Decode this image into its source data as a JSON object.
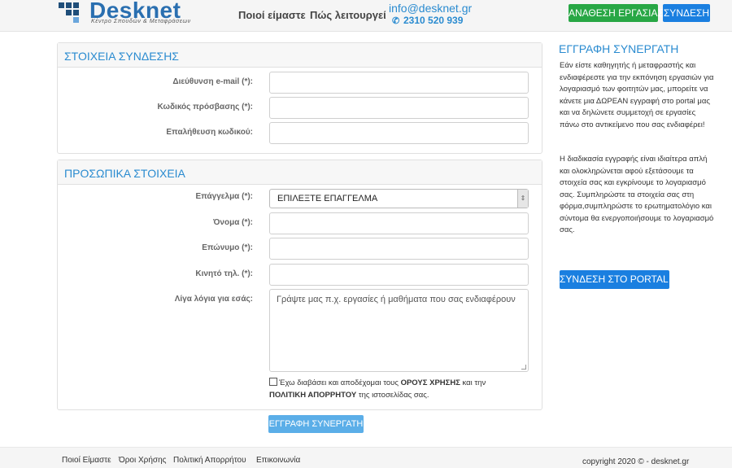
{
  "header": {
    "logo_text": "Desknet",
    "logo_subtitle": "Κέντρο Σπουδών & Μεταφράσεων",
    "nav": [
      "Ποιοί είμαστε",
      "Πώς λειτουργεί"
    ],
    "email": "info@desknet.gr",
    "phone": "2310 520 939",
    "assign_button": "ΑΝΑΘΕΣΗ ΕΡΓΑΣΙΑΣ",
    "login_button": "ΣΥΝΔΕΣΗ",
    "colors": {
      "green": "#28a745",
      "blue": "#1a7fe0"
    }
  },
  "login_section": {
    "title": "ΣΤΟΙΧΕΙΑ ΣΥΝΔΕΣΗΣ",
    "fields": [
      {
        "label": "Διεύθυνση e-mail (*):",
        "value": ""
      },
      {
        "label": "Κωδικός πρόσβασης (*):",
        "value": ""
      },
      {
        "label": "Επαλήθευση κωδικού:",
        "value": ""
      }
    ]
  },
  "personal_section": {
    "title": "ΠΡΟΣΩΠΙΚΑ ΣΤΟΙΧΕΙΑ",
    "profession_label": "Επάγγελμα (*):",
    "profession_selected": "ΕΠΙΛΕΞΤΕ ΕΠΑΓΓΕΛΜΑ",
    "fields": [
      {
        "label": "Όνομα (*):",
        "value": ""
      },
      {
        "label": "Επώνυμο (*):",
        "value": ""
      },
      {
        "label": "Κινητό τηλ. (*):",
        "value": ""
      }
    ],
    "about_label": "Λίγα λόγια για εσάς:",
    "about_placeholder": "Γράψτε μας π.χ. εργασίες ή μαθήματα που σας ενδιαφέρουν",
    "terms_pre": "Έχω διαβάσει και αποδέχομαι τους",
    "terms_link": "ΟΡΟΥΣ ΧΡΗΣΗΣ",
    "terms_mid": "και την",
    "privacy_link": "ΠΟΛΙΤΙΚΗ ΑΠΟΡΡΗΤΟΥ",
    "terms_post": "της ιστοσελίδας σας."
  },
  "submit_button": "ΕΓΓΡΑΦΗ ΣΥΝΕΡΓΑΤΗ",
  "sidebar": {
    "title": "ΕΓΓΡΑΦΗ ΣΥΝΕΡΓΑΤΗ",
    "paragraph1": "Εάν είστε καθηγητής ή μεταφραστής και ενδιαφέρεστε για την εκπόνηση εργασιών για λογαριασμό των φοιτητών μας, μπορείτε να κάνετε μια ΔΩΡΕΑΝ εγγραφή στο portal μας και να δηλώνετε συμμετοχή σε εργασίες πάνω στο αντικείμενο που σας ενδιαφέρει!",
    "paragraph2": "Η διαδικασία εγγραφής είναι ιδιαίτερα απλή και ολοκληρώνεται αφού εξετάσουμε τα στοιχεία σας και εγκρίνουμε το λογαριασμό σας. Συμπληρώστε τα στοιχεία σας στη φόρμα,συμπληρώστε το ερωτηματολόγιο και σύντομα θα ενεργοποιήσουμε το λογαριασμό σας.",
    "portal_button": "ΣΥΝΔΕΣΗ ΣΤΟ PORTAL"
  },
  "footer": {
    "links": [
      "Ποιοί Είμαστε",
      "Όροι Χρήσης",
      "Πολιτική Απορρήτου",
      "Επικοινωνία"
    ],
    "copyright": "copyright 2020 © - desknet.gr"
  }
}
